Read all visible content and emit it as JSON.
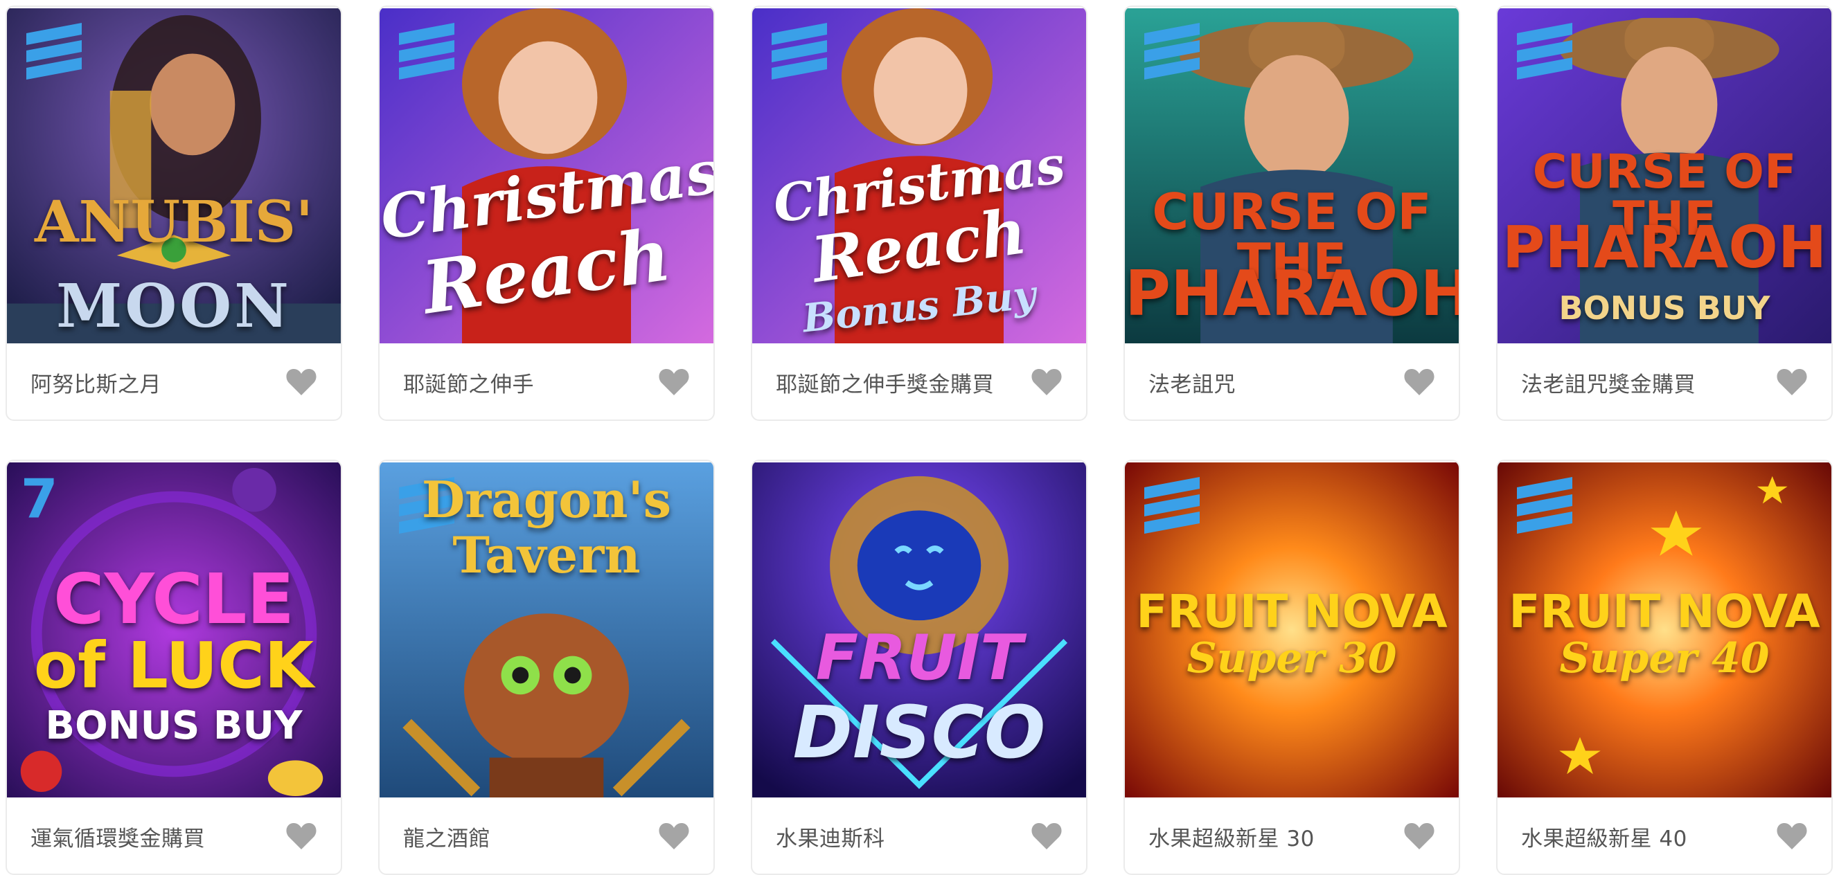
{
  "games": [
    {
      "name": "阿努比斯之月",
      "art_title": "ANUBIS'",
      "art_subtitle": "MOON",
      "art_extra": "",
      "theme": {
        "bg1": "#2a2e6e",
        "bg2": "#6a3a8a",
        "title": "#e6a83a"
      },
      "icon": "heart-icon"
    },
    {
      "name": "耶誕節之伸手",
      "art_title": "Christmas",
      "art_subtitle": "Reach",
      "art_extra": "",
      "theme": {
        "bg1": "#6a3fd8",
        "bg2": "#c45adf",
        "title": "#ffffff"
      },
      "icon": "heart-icon"
    },
    {
      "name": "耶誕節之伸手獎金購買",
      "art_title": "Christmas",
      "art_subtitle": "Reach",
      "art_extra": "Bonus Buy",
      "theme": {
        "bg1": "#6a3fd8",
        "bg2": "#c45adf",
        "title": "#ffffff"
      },
      "icon": "heart-icon"
    },
    {
      "name": "法老詛咒",
      "art_title": "CURSE OF THE",
      "art_subtitle": "PHARAOH",
      "art_extra": "",
      "theme": {
        "bg1": "#1f7c73",
        "bg2": "#0d3f46",
        "title": "#e44a1a"
      },
      "icon": "heart-icon"
    },
    {
      "name": "法老詛咒獎金購買",
      "art_title": "CURSE OF THE",
      "art_subtitle": "PHARAOH",
      "art_extra": "BONUS BUY",
      "theme": {
        "bg1": "#5a2aa8",
        "bg2": "#2d1a6e",
        "title": "#e44a1a"
      },
      "icon": "heart-icon"
    },
    {
      "name": "運氣循環獎金購買",
      "art_title": "CYCLE",
      "art_subtitle": "of LUCK",
      "art_extra": "BONUS BUY",
      "theme": {
        "bg1": "#6a1fa8",
        "bg2": "#2a0f5a",
        "title": "#ff4fd8"
      },
      "icon": "heart-icon"
    },
    {
      "name": "龍之酒館",
      "art_title": "Dragon's",
      "art_subtitle": "Tavern",
      "art_extra": "",
      "theme": {
        "bg1": "#3a7fc8",
        "bg2": "#1f4a7a",
        "title": "#f3c43a"
      },
      "icon": "heart-icon"
    },
    {
      "name": "水果迪斯科",
      "art_title": "FRUIT",
      "art_subtitle": "DISCO",
      "art_extra": "",
      "theme": {
        "bg1": "#3a1fa8",
        "bg2": "#1a0f5a",
        "title": "#e85adf"
      },
      "icon": "heart-icon"
    },
    {
      "name": "水果超級新星 30",
      "art_title": "FRUIT NOVA",
      "art_subtitle": "Super 30",
      "art_extra": "",
      "theme": {
        "bg1": "#ff9a1a",
        "bg2": "#a2160a",
        "title": "#ffd21a"
      },
      "icon": "heart-icon"
    },
    {
      "name": "水果超級新星 40",
      "art_title": "FRUIT NOVA",
      "art_subtitle": "Super 40",
      "art_extra": "",
      "theme": {
        "bg1": "#ff8a1a",
        "bg2": "#9a120a",
        "title": "#ffd21a"
      },
      "icon": "heart-icon"
    }
  ],
  "colors": {
    "provider_logo": "#3aa0e8",
    "heart": "#a5a5a5",
    "caption_text": "#555555",
    "card_border": "#ebebeb"
  }
}
